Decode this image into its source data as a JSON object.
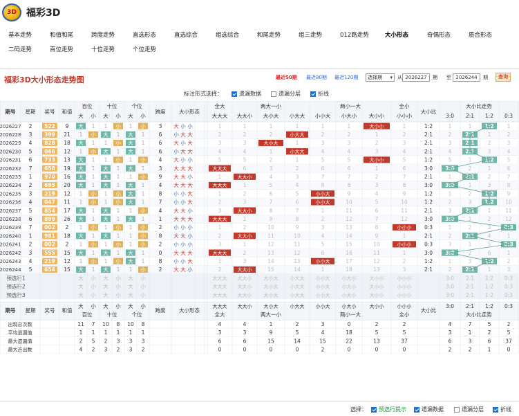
{
  "app": {
    "logo": "3D",
    "title": "福彩3D"
  },
  "nav": [
    "基本走势",
    "和值和尾",
    "跨度走势",
    "直选形态",
    "直选综合",
    "组选综合",
    "和尾走势",
    "组三走势",
    "012路走势",
    "大小形态",
    "奇偶形态",
    "质合形态",
    "二码走势",
    "百位走势",
    "十位走势",
    "个位走势"
  ],
  "nav_active": 9,
  "panel": {
    "title": "福彩3D大小形态走势图",
    "recent": [
      "最近50期",
      "最近80期",
      "最近120期"
    ],
    "select_label": "选择期",
    "from_label": "从",
    "from": "2026227",
    "qi": "期",
    "to_label": "至",
    "to": "2026244",
    "query": "查询"
  },
  "mark_options": {
    "label": "标注形式选择：",
    "items": [
      {
        "label": "遗漏数据",
        "checked": true
      },
      {
        "label": "遗漏分层",
        "checked": false
      },
      {
        "label": "折线",
        "checked": true
      }
    ]
  },
  "headers": {
    "qihao": "期号",
    "xingqi": "星期",
    "jianghao": "奖号",
    "hezhi": "和值",
    "bai": "百位",
    "shi": "十位",
    "ge": "个位",
    "kuadu": "跨度",
    "dxxt": "大小形态",
    "all_big": "全大",
    "mix1": "两大一小",
    "mix2": "两小一大",
    "all_small": "全小",
    "dxb": "大小比",
    "dxbzs": "大小比走势",
    "da": "大",
    "xiao": "小",
    "pats": [
      "大大大",
      "大大小",
      "大小大",
      "小大大",
      "小小大",
      "小大小",
      "大小小",
      "小小小"
    ],
    "ratios": [
      "3:0",
      "2:1",
      "1:2",
      "0:3"
    ]
  },
  "rows": [
    {
      "qi": "2026227",
      "w": "2",
      "n": "522",
      "h": "9",
      "k": "3",
      "pi": "2",
      "r": "1:2"
    },
    {
      "qi": "2026228",
      "w": "3",
      "n": "399",
      "h": "21",
      "k": "6",
      "pi": "4",
      "r": "2:1"
    },
    {
      "qi": "2026229",
      "w": "4",
      "n": "828",
      "h": "18",
      "k": "6",
      "pi": "2",
      "r": "2:1"
    },
    {
      "qi": "2026230",
      "w": "5",
      "n": "066",
      "h": "12",
      "k": "6",
      "pi": "3",
      "r": "2:1"
    },
    {
      "qi": "2026231",
      "w": "6",
      "n": "733",
      "h": "13",
      "k": "4",
      "pi": "6",
      "r": "1:2"
    },
    {
      "qi": "2026232",
      "w": "7",
      "n": "658",
      "h": "19",
      "k": "3",
      "pi": "0",
      "r": "3:0"
    },
    {
      "qi": "2026233",
      "w": "1",
      "n": "970",
      "h": "16",
      "k": "9",
      "pi": "1",
      "r": "2:1"
    },
    {
      "qi": "2026234",
      "w": "2",
      "n": "695",
      "h": "20",
      "k": "4",
      "pi": "0",
      "r": "3:0"
    },
    {
      "qi": "2026235",
      "w": "3",
      "n": "219",
      "h": "12",
      "k": "8",
      "pi": "4",
      "r": "1:2"
    },
    {
      "qi": "2026236",
      "w": "4",
      "n": "047",
      "h": "11",
      "k": "7",
      "pi": "4",
      "r": "1:2"
    },
    {
      "qi": "2026237",
      "w": "5",
      "n": "854",
      "h": "17",
      "k": "4",
      "pi": "1",
      "r": "2:1"
    },
    {
      "qi": "2026238",
      "w": "6",
      "n": "899",
      "h": "26",
      "k": "1",
      "pi": "0",
      "r": "3:0"
    },
    {
      "qi": "2026239",
      "w": "7",
      "n": "002",
      "h": "2",
      "k": "2",
      "pi": "7",
      "r": "0:3"
    },
    {
      "qi": "2026240",
      "w": "1",
      "n": "981",
      "h": "18",
      "k": "8",
      "pi": "1",
      "r": "2:1"
    },
    {
      "qi": "2026241",
      "w": "2",
      "n": "002",
      "h": "2",
      "k": "2",
      "pi": "7",
      "r": "0:3"
    },
    {
      "qi": "2026242",
      "w": "3",
      "n": "555",
      "h": "15",
      "k": "0",
      "pi": "0",
      "r": "3:0"
    },
    {
      "qi": "2026243",
      "w": "4",
      "n": "219",
      "h": "12",
      "k": "8",
      "pi": "4",
      "r": "1:2"
    },
    {
      "qi": "2026244",
      "w": "5",
      "n": "654",
      "h": "15",
      "k": "2",
      "pi": "1",
      "r": "2:1"
    }
  ],
  "predict": [
    "预选行1",
    "预选行2",
    "预选行3"
  ],
  "stats": [
    {
      "label": "出现总次数",
      "pos": [
        "11",
        "7",
        "10",
        "8",
        "10",
        "8"
      ],
      "pat": [
        "4",
        "4",
        "1",
        "2",
        "3",
        "0",
        "2",
        "2"
      ],
      "ratio": [
        "4",
        "7",
        "5",
        "2"
      ]
    },
    {
      "label": "平均遗漏值",
      "pos": [
        "1",
        "1",
        "1",
        "1",
        "1",
        "1"
      ],
      "pat": [
        "3",
        "3",
        "9",
        "5",
        "4",
        "18",
        "5",
        "5"
      ],
      "ratio": [
        "3",
        "1",
        "2",
        "5"
      ]
    },
    {
      "label": "最大遗漏值",
      "pos": [
        "2",
        "5",
        "2",
        "3",
        "3",
        "3"
      ],
      "pat": [
        "6",
        "6",
        "15",
        "14",
        "15",
        "22",
        "13",
        "37"
      ],
      "ratio": [
        "6",
        "3",
        "6",
        "37"
      ]
    },
    {
      "label": "最大连出数",
      "pos": [
        "4",
        "2",
        "3",
        "2",
        "3",
        "2"
      ],
      "pat": [
        "0",
        "0",
        "0",
        "0",
        "2",
        "0",
        "0",
        "0"
      ],
      "ratio": [
        "2",
        "2",
        "1",
        "0"
      ]
    }
  ],
  "bottom": {
    "label": "选择：",
    "items": [
      {
        "label": "预选行提示",
        "checked": true,
        "green": true
      },
      {
        "label": "遗漏数据",
        "checked": true
      },
      {
        "label": "遗漏分层",
        "checked": false
      },
      {
        "label": "折线",
        "checked": true
      }
    ]
  }
}
